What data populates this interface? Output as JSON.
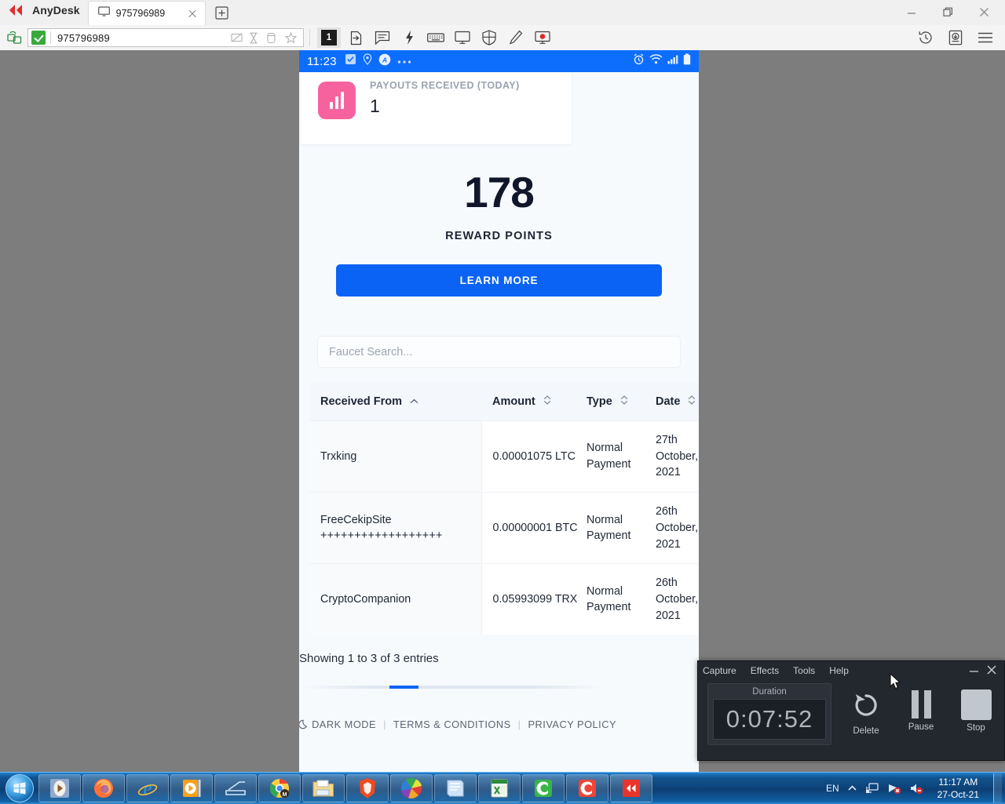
{
  "anydesk": {
    "app_name": "AnyDesk",
    "tab": {
      "label": "975796989",
      "icon": "monitor-icon",
      "close_icon": "close-icon"
    },
    "new_tab_icon": "new-tab-icon",
    "window_controls": {
      "minimize": "minimize-icon",
      "restore": "restore-icon",
      "close": "close-icon"
    },
    "toolbar": {
      "left_icon": "connections-icon",
      "address_value": "975796989",
      "status_icon": "connected-check-icon",
      "address_icons": [
        "screen-off-icon",
        "hourglass-icon",
        "clipboard-icon",
        "favorite-star-icon"
      ],
      "session_badge": "1",
      "buttons": [
        "file-transfer-icon",
        "chat-icon",
        "actions-lightning-icon",
        "keyboard-icon",
        "display-icon",
        "permissions-shield-icon",
        "whiteboard-pen-icon",
        "record-icon"
      ],
      "right_buttons": [
        "history-icon",
        "download-icon",
        "menu-icon"
      ]
    }
  },
  "phone": {
    "statusbar": {
      "time": "11:23",
      "left_icons": [
        "tasks-icon",
        "location-icon",
        "anydesk-app-icon",
        "more-dots-icon"
      ],
      "right_icons": [
        "alarm-icon",
        "wifi-icon",
        "signal-icon",
        "battery-icon"
      ]
    },
    "payout_card": {
      "icon": "bar-chart-icon",
      "label": "PAYOUTS RECEIVED (TODAY)",
      "value": "1"
    },
    "reward": {
      "number": "178",
      "label": "REWARD POINTS",
      "button": "LEARN MORE"
    },
    "search": {
      "placeholder": "Faucet Search...",
      "value": ""
    },
    "table": {
      "columns": [
        {
          "label": "Received From",
          "sort_icon": "sort-asc-icon"
        },
        {
          "label": "Amount",
          "sort_icon": "sort-both-icon"
        },
        {
          "label": "Type",
          "sort_icon": "sort-both-icon"
        },
        {
          "label": "Date",
          "sort_icon": "sort-both-icon"
        }
      ],
      "rows": [
        {
          "received_from": "Trxking",
          "received_from_extra": "",
          "amount": "0.00001075 LTC",
          "type": "Normal Payment",
          "date": "27th October, 2021"
        },
        {
          "received_from": "FreeCekipSite",
          "received_from_extra": "++++++++++++++++++",
          "amount": "0.00000001 BTC",
          "type": "Normal Payment",
          "date": "26th October, 2021"
        },
        {
          "received_from": "CryptoCompanion",
          "received_from_extra": "",
          "amount": "0.05993099 TRX",
          "type": "Normal Payment",
          "date": "26th October, 2021"
        }
      ]
    },
    "entries_text": "Showing 1 to 3 of 3 entries",
    "footer": {
      "dark_mode_icon": "moon-icon",
      "dark_mode": "DARK MODE",
      "separator": "|",
      "terms": "TERMS & CONDITIONS",
      "privacy": "PRIVACY POLICY"
    },
    "accent_color": "#0b63f6"
  },
  "recorder": {
    "menu": [
      "Capture",
      "Effects",
      "Tools",
      "Help"
    ],
    "minimize_icon": "minimize-icon",
    "close_icon": "close-icon",
    "duration_label": "Duration",
    "duration_value": "0:07:52",
    "controls": [
      {
        "label": "Delete",
        "icon": "undo-delete-icon"
      },
      {
        "label": "Pause",
        "icon": "pause-icon"
      },
      {
        "label": "Stop",
        "icon": "stop-icon"
      }
    ]
  },
  "taskbar": {
    "start": "start-orb-icon",
    "items": [
      "media-player-icon",
      "firefox-icon",
      "internet-explorer-icon",
      "video-player-icon",
      "scanner-icon",
      "chrome-icon",
      "file-explorer-icon",
      "brave-icon",
      "color-wheel-icon",
      "notepad-icon",
      "excel-icon",
      "camtasia-green-icon",
      "camtasia-red-icon",
      "anydesk-icon"
    ],
    "tray": {
      "language": "EN",
      "chevron_icon": "show-hidden-icons-icon",
      "network_icon": "network-icon",
      "network_alert_icon": "network-error-icon",
      "volume_icon": "volume-muted-icon"
    },
    "clock": {
      "time": "11:17 AM",
      "date": "27-Oct-21"
    }
  }
}
